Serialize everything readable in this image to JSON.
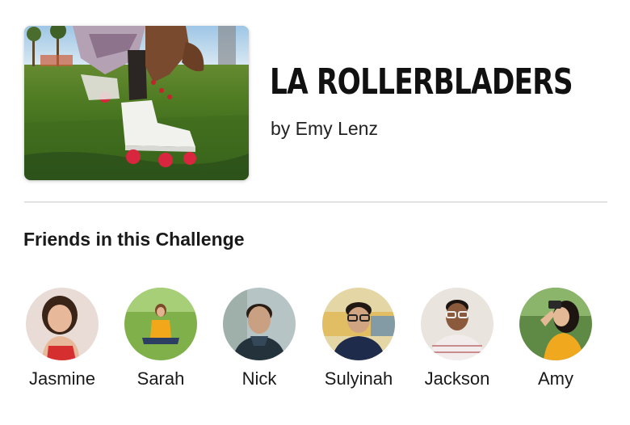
{
  "challenge": {
    "title": "LA ROLLERBLADERS",
    "author": "by Emy Lenz",
    "photo_icon": "roller-skate-photo"
  },
  "friends_section": {
    "heading": "Friends in this Challenge",
    "friends": [
      {
        "name": "Jasmine"
      },
      {
        "name": "Sarah"
      },
      {
        "name": "Nick"
      },
      {
        "name": "Sulyinah"
      },
      {
        "name": "Jackson"
      },
      {
        "name": "Amy"
      }
    ]
  },
  "colors": {
    "divider": "#e2e2e2",
    "text": "#111111"
  }
}
